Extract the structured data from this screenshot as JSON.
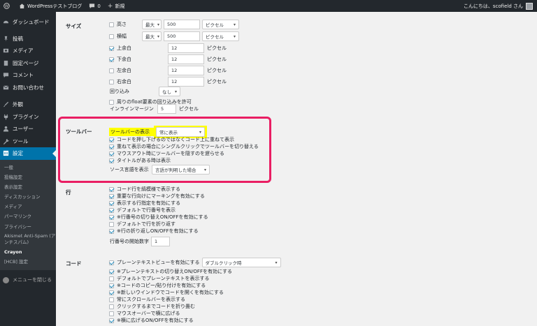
{
  "adminbar": {
    "site": "WordPressテストブログ",
    "comments": "0",
    "new": "新規",
    "greeting": "こんにちは、scofield さん"
  },
  "sidebar": {
    "items": [
      {
        "label": "ダッシュボード",
        "icon": "dashboard-icon"
      },
      {
        "label": "投稿",
        "icon": "pin-icon"
      },
      {
        "label": "メディア",
        "icon": "media-icon"
      },
      {
        "label": "固定ページ",
        "icon": "page-icon"
      },
      {
        "label": "コメント",
        "icon": "comment-icon"
      },
      {
        "label": "お問い合わせ",
        "icon": "mail-icon"
      }
    ],
    "items2": [
      {
        "label": "外観",
        "icon": "brush-icon"
      },
      {
        "label": "プラグイン",
        "icon": "plugin-icon"
      },
      {
        "label": "ユーザー",
        "icon": "user-icon"
      },
      {
        "label": "ツール",
        "icon": "wrench-icon"
      },
      {
        "label": "設定",
        "icon": "settings-icon"
      }
    ],
    "sub": [
      "一般",
      "投稿設定",
      "表示設定",
      "ディスカッション",
      "メディア",
      "パーマリンク",
      "プライバシー",
      "Akismet Anti-Spam (アンチスパム)",
      "Crayon",
      "[HCB] 設定"
    ],
    "collapse": "メニューを閉じる"
  },
  "size": {
    "label": "サイズ",
    "height": {
      "label": "高さ",
      "mode": "最大",
      "value": "500",
      "unit": "ピクセル"
    },
    "width": {
      "label": "横幅",
      "mode": "最大",
      "value": "500",
      "unit": "ピクセル"
    },
    "margins": [
      {
        "label": "上余白",
        "value": "12",
        "unit": "ピクセル",
        "checked": true
      },
      {
        "label": "下余白",
        "value": "12",
        "unit": "ピクセル",
        "checked": true
      },
      {
        "label": "左余白",
        "value": "12",
        "unit": "ピクセル",
        "checked": false
      },
      {
        "label": "右余白",
        "value": "12",
        "unit": "ピクセル",
        "checked": false
      }
    ],
    "wrap_label": "回り込み",
    "wrap_value": "なし",
    "float_label": "周りのfloat要素の回り込みを許可",
    "inline_margin_label": "インラインマージン",
    "inline_margin_value": "5",
    "inline_margin_unit": "ピクセル"
  },
  "toolbar": {
    "label": "ツールバー",
    "display_label": "ツールバーの表示",
    "display_value": "常に表示",
    "options": [
      "コードを押し下げるのではなくコード上に重ねて表示",
      "重ねて表示の場合にシングルクリックでツールバーを切り替える",
      "マウスアウト時にツールバーを隠すのを遅らせる",
      "タイトルがある時は表示"
    ],
    "source_lang_label": "ソース言語を表示",
    "source_lang_value": "言語が判明した場合"
  },
  "lines": {
    "label": "行",
    "options": [
      "コード行を縞模様で表示する",
      "重要な行向けにマーキングを有効にする",
      "表示する行指定を有効にする",
      "デフォルトで行番号を表示",
      "※行番号の切り替えON/OFFを有効にする",
      "デフォルトで行を折り返す",
      "※行の折り返しON/OFFを有効にする"
    ],
    "checked": [
      true,
      true,
      true,
      true,
      true,
      false,
      true
    ],
    "start_label": "行番号の開始数字",
    "start_value": "1"
  },
  "code": {
    "label": "コード",
    "plain_label": "プレーンテキストビューを有効にする",
    "plain_value": "ダブルクリック時",
    "options": [
      "※プレーンテキストの切り替えON/OFFを有効にする",
      "デフォルトでプレーンテキストを表示する",
      "※コードのコピー/貼り付けを有効にする",
      "※新しいウインドウでコードを開くを有効にする",
      "常にスクロールバーを表示する",
      "クリックするまでコードを折り畳む",
      "マウスオーバーで横に広げる",
      "※横に広げるON/OFFを有効にする"
    ],
    "checked": [
      true,
      false,
      true,
      true,
      false,
      false,
      false,
      true
    ]
  }
}
